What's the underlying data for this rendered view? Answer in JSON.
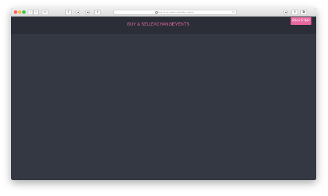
{
  "browser": {
    "address_placeholder": "Search or enter website name",
    "back_label": "‹",
    "forward_label": "›",
    "sidebar_label": "▭",
    "share_label": "⇪",
    "tabs_label": "⧉",
    "download_label": "⇩",
    "reload_label": "↻"
  },
  "nav": {
    "links": [
      {
        "label": "BUY & SELL"
      },
      {
        "label": "EXCHANGE"
      },
      {
        "label": "EVENTS"
      }
    ],
    "register_label": "REGISTER"
  },
  "colors": {
    "accent": "#e9679f",
    "navbar_bg": "#2b2e36",
    "page_bg": "#343843"
  }
}
